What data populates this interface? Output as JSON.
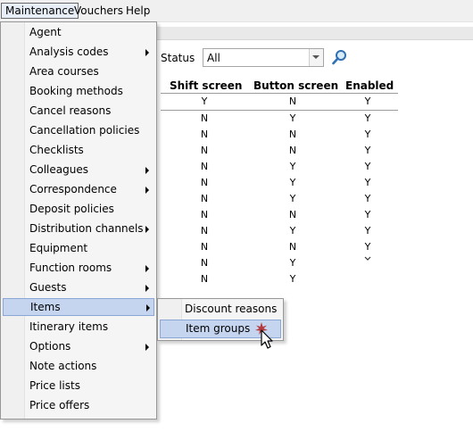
{
  "menubar": {
    "items": [
      {
        "label": "Maintenance"
      },
      {
        "label": "Vouchers"
      },
      {
        "label": "Help"
      }
    ]
  },
  "filter": {
    "status_label": "Status",
    "status_value": "All"
  },
  "grid": {
    "headers": [
      "Shift screen",
      "Button screen",
      "Enabled"
    ],
    "rows": [
      [
        "",
        "N",
        "Y"
      ],
      [
        "N",
        "Y",
        "Y"
      ],
      [
        "N",
        "N",
        "Y"
      ],
      [
        "N",
        "N",
        "Y"
      ],
      [
        "N",
        "Y",
        "Y"
      ],
      [
        "N",
        "Y",
        "Y"
      ],
      [
        "N",
        "Y",
        "Y"
      ],
      [
        "N",
        "N",
        "Y"
      ],
      [
        "N",
        "Y",
        "Y"
      ],
      [
        "N",
        "N",
        "Y"
      ],
      [
        "N",
        "Y",
        ""
      ],
      [
        "N",
        "Y",
        ""
      ]
    ],
    "first_row_shift_value": "Y"
  },
  "maintenance_menu": {
    "items": [
      {
        "label": "Agent"
      },
      {
        "label": "Analysis codes"
      },
      {
        "label": "Area courses"
      },
      {
        "label": "Booking methods"
      },
      {
        "label": "Cancel reasons"
      },
      {
        "label": "Cancellation policies"
      },
      {
        "label": "Checklists"
      },
      {
        "label": "Colleagues"
      },
      {
        "label": "Correspondence"
      },
      {
        "label": "Deposit policies"
      },
      {
        "label": "Distribution channels"
      },
      {
        "label": "Equipment"
      },
      {
        "label": "Function rooms"
      },
      {
        "label": "Guests"
      },
      {
        "label": "Items"
      },
      {
        "label": "Itinerary items"
      },
      {
        "label": "Options"
      },
      {
        "label": "Note actions"
      },
      {
        "label": "Price lists"
      },
      {
        "label": "Price offers"
      }
    ]
  },
  "items_submenu": {
    "items": [
      {
        "label": "Discount reasons"
      },
      {
        "label": "Item groups"
      }
    ]
  },
  "colors": {
    "highlight": "#c5d5ef",
    "highlight_border": "#8aa8d6",
    "menu_background": "#f5f5f5"
  }
}
